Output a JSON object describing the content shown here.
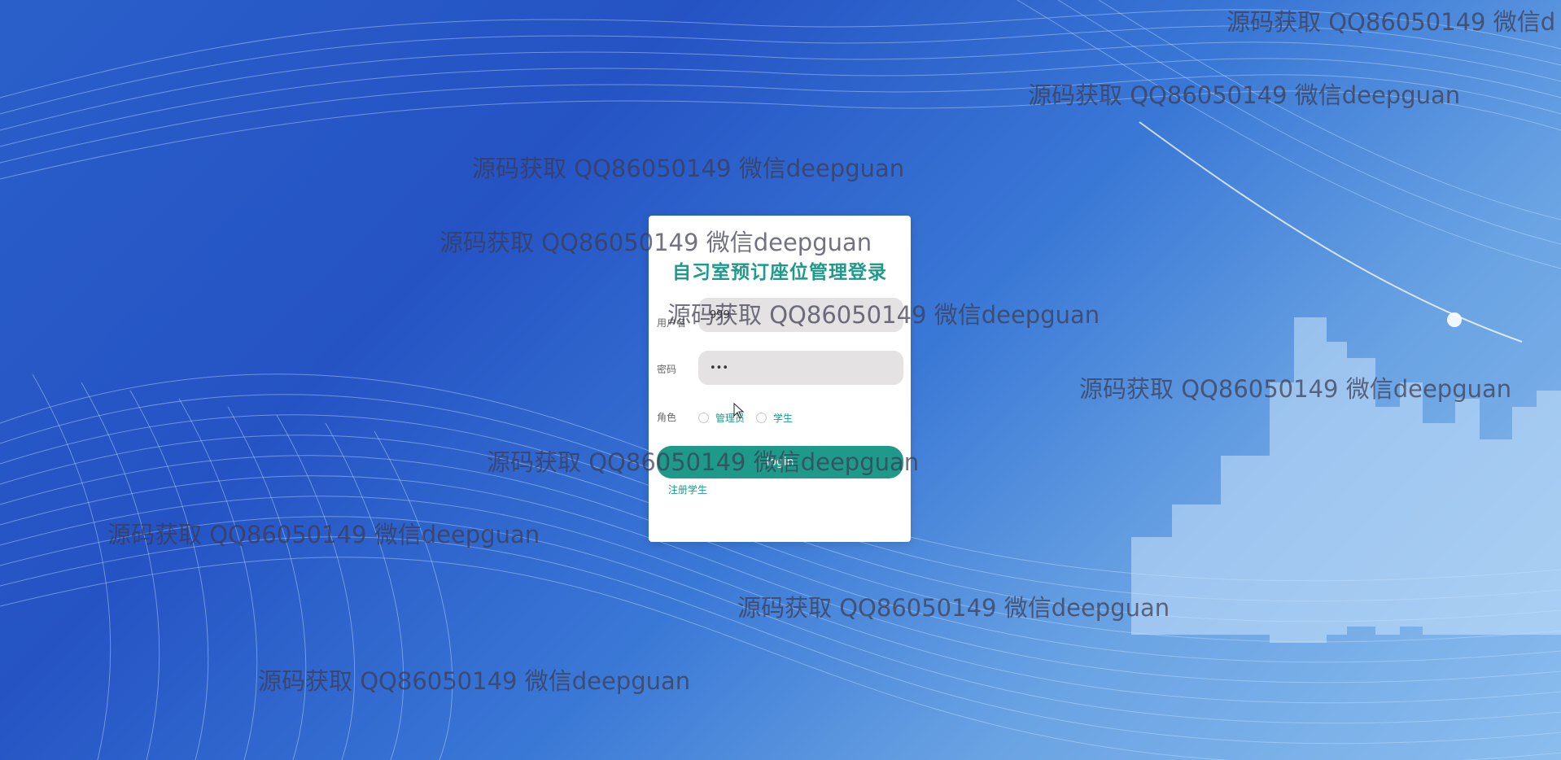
{
  "login": {
    "title": "自习室预订座位管理登录",
    "username_label": "用户名",
    "username_value": "999",
    "password_label": "密码",
    "password_value": "•••",
    "role_label": "角色",
    "roles": [
      "管理员",
      "学生"
    ],
    "login_button": "login",
    "register_link": "注册学生"
  },
  "watermark_text": "源码获取 QQ86050149 微信deepguan",
  "watermark_text_cut": "源码获取 QQ86050149 微信d",
  "colors": {
    "accent": "#1f9a8a",
    "background": "#2a5fc9",
    "input_bg": "#e4e2e2"
  }
}
